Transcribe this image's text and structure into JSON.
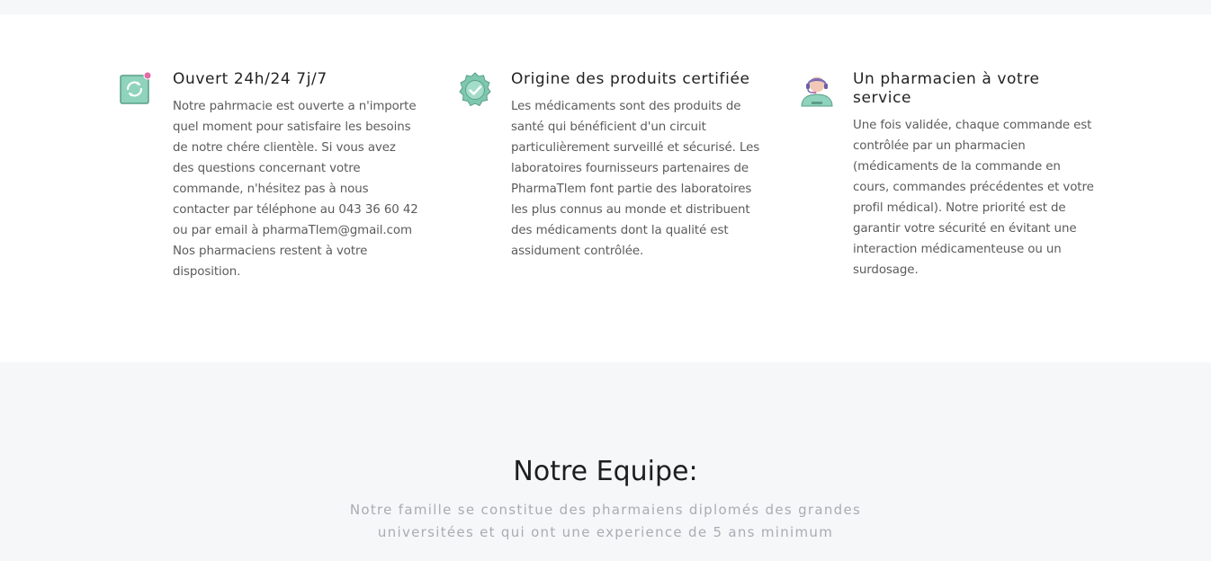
{
  "features": [
    {
      "icon": "refresh-clock-icon",
      "title": "Ouvert 24h/24 7j/7",
      "text": "Notre pahrmacie est ouverte a n'importe quel moment pour satisfaire les besoins de notre chére clientèle. Si vous avez des questions concernant votre commande, n'hésitez pas à nous contacter par téléphone au 043 36 60 42 ou par email à pharmaTlem@gmail.com Nos pharmaciens restent à votre disposition."
    },
    {
      "icon": "certified-badge-icon",
      "title": "Origine des produits certifiée",
      "text": "Les médicaments sont des produits de santé qui bénéficient d'un circuit particulièrement surveillé et sécurisé. Les laboratoires fournisseurs partenaires de PharmaTlem font partie des laboratoires les plus connus au monde et distribuent des médicaments dont la qualité est assidument contrôlée."
    },
    {
      "icon": "pharmacist-support-icon",
      "title": "Un pharmacien à votre service",
      "text": "Une fois validée, chaque commande est contrôlée par un pharmacien (médicaments de la commande en cours, commandes précédentes et votre profil médical). Notre priorité est de garantir votre sécurité en évitant une interaction médicamenteuse ou un surdosage."
    }
  ],
  "team": {
    "title": "Notre Equipe:",
    "subtitle": "Notre famille se constitue des pharmaiens diplomés des grandes universitées et qui ont une experience de 5 ans minimum"
  },
  "colors": {
    "accent_green": "#5cbfa0",
    "accent_pink": "#e26aa6",
    "band_gray": "#f6f7f9"
  }
}
